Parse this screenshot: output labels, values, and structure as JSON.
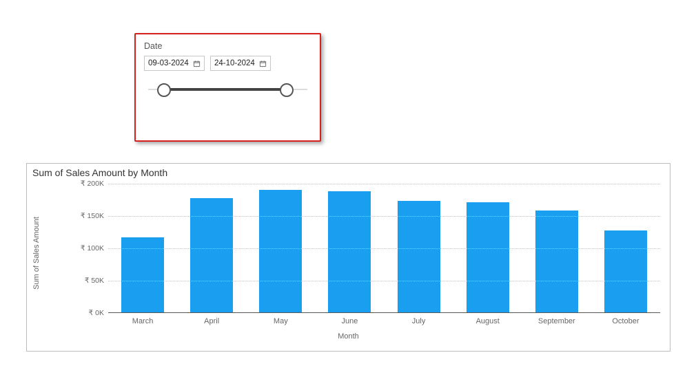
{
  "slicer": {
    "title": "Date",
    "start_value": "09-03-2024",
    "end_value": "24-10-2024",
    "range": {
      "start_pct": 12,
      "end_pct": 85
    }
  },
  "chart": {
    "title": "Sum of Sales Amount by Month",
    "ylabel": "Sum of Sales Amount",
    "xlabel": "Month",
    "currency": "₹",
    "y_ticks": [
      0,
      50,
      100,
      150,
      200
    ],
    "y_tick_suffix": "K",
    "categories": [
      "March",
      "April",
      "May",
      "June",
      "July",
      "August",
      "September",
      "October"
    ]
  },
  "chart_data": {
    "type": "bar",
    "title": "Sum of Sales Amount by Month",
    "xlabel": "Month",
    "ylabel": "Sum of Sales Amount",
    "ylim": [
      0,
      200
    ],
    "y_unit": "₹ thousands",
    "categories": [
      "March",
      "April",
      "May",
      "June",
      "July",
      "August",
      "September",
      "October"
    ],
    "values": [
      117,
      178,
      190,
      188,
      173,
      171,
      159,
      128
    ]
  },
  "colors": {
    "bar": "#199ef0",
    "highlight_border": "#d6201c"
  }
}
